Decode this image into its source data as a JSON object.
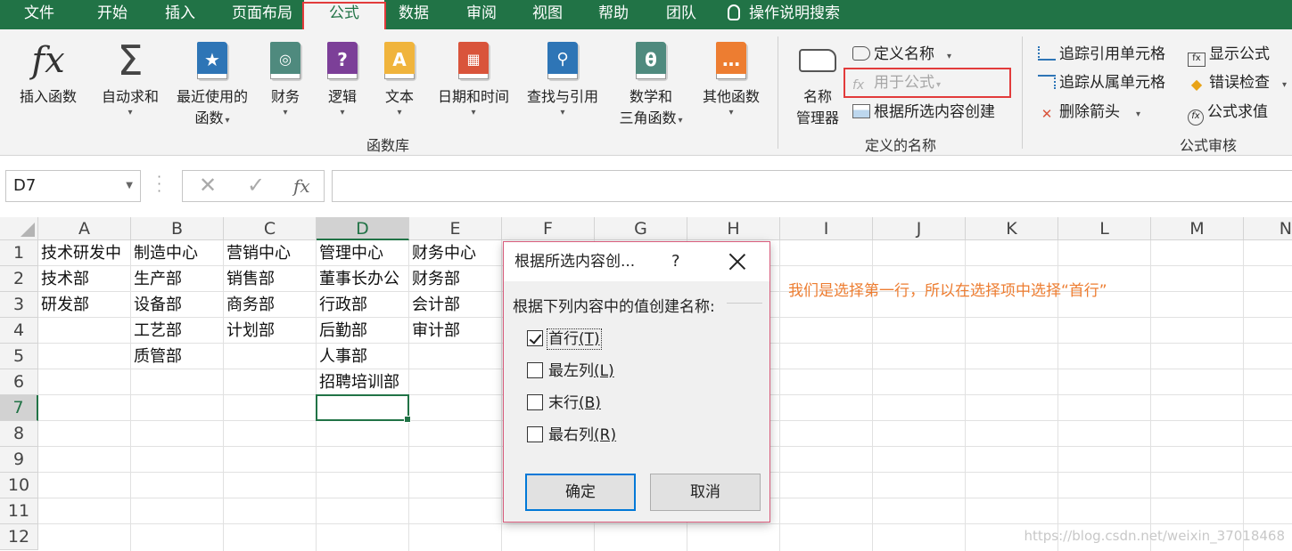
{
  "tabs": [
    "文件",
    "开始",
    "插入",
    "页面布局",
    "公式",
    "数据",
    "审阅",
    "视图",
    "帮助",
    "团队"
  ],
  "active_tab": "公式",
  "tell_me": "操作说明搜索",
  "ribbon": {
    "function_library": {
      "insert_function": "插入函数",
      "autosum": "自动求和",
      "recent_1": "最近使用的",
      "recent_2": "函数",
      "financial": "财务",
      "logical": "逻辑",
      "text": "文本",
      "datetime": "日期和时间",
      "lookup": "查找与引用",
      "math_1": "数学和",
      "math_2": "三角函数",
      "more": "其他函数",
      "group_label": "函数库"
    },
    "defined_names": {
      "name_manager_1": "名称",
      "name_manager_2": "管理器",
      "define_name": "定义名称",
      "use_in_formula": "用于公式",
      "create_from_selection": "根据所选内容创建",
      "group_label": "定义的名称"
    },
    "formula_auditing": {
      "trace_precedents": "追踪引用单元格",
      "trace_dependents": "追踪从属单元格",
      "remove_arrows": "删除箭头",
      "show_formulas": "显示公式",
      "error_checking": "错误检查",
      "evaluate_formula": "公式求值",
      "group_label": "公式审核"
    }
  },
  "formula_bar": {
    "name_box": "D7",
    "fx": "fx",
    "value": ""
  },
  "grid": {
    "columns": [
      "A",
      "B",
      "C",
      "D",
      "E",
      "F",
      "G",
      "H",
      "I",
      "J",
      "K",
      "L",
      "M",
      "N"
    ],
    "rows": [
      "1",
      "2",
      "3",
      "4",
      "5",
      "6",
      "7",
      "8",
      "9",
      "10",
      "11",
      "12"
    ],
    "selected_column": "D",
    "selected_row": "7",
    "cells": {
      "A": [
        "技术研发中",
        "技术部",
        "研发部",
        "",
        "",
        ""
      ],
      "B": [
        "制造中心",
        "生产部",
        "设备部",
        "工艺部",
        "质管部",
        ""
      ],
      "C": [
        "营销中心",
        "销售部",
        "商务部",
        "计划部",
        "",
        ""
      ],
      "D": [
        "管理中心",
        "董事长办公",
        "行政部",
        "后勤部",
        "人事部",
        "招聘培训部"
      ],
      "E": [
        "财务中心",
        "财务部",
        "会计部",
        "审计部",
        "",
        ""
      ]
    }
  },
  "annotation": "我们是选择第一行，所以在选择项中选择“首行”",
  "watermark": "https://blog.csdn.net/weixin_37018468",
  "dialog": {
    "title": "根据所选内容创...",
    "help": "?",
    "prompt": "根据下列内容中的值创建名称:",
    "options": [
      {
        "label": "首行",
        "key": "(T)",
        "checked": true
      },
      {
        "label": "最左列",
        "key": "(L)",
        "checked": false
      },
      {
        "label": "末行",
        "key": "(B)",
        "checked": false
      },
      {
        "label": "最右列",
        "key": "(R)",
        "checked": false
      }
    ],
    "ok": "确定",
    "cancel": "取消"
  },
  "colors": {
    "excel_green": "#217346",
    "highlight_red": "#e23b3b",
    "annotation_orange": "#ed7d31"
  }
}
